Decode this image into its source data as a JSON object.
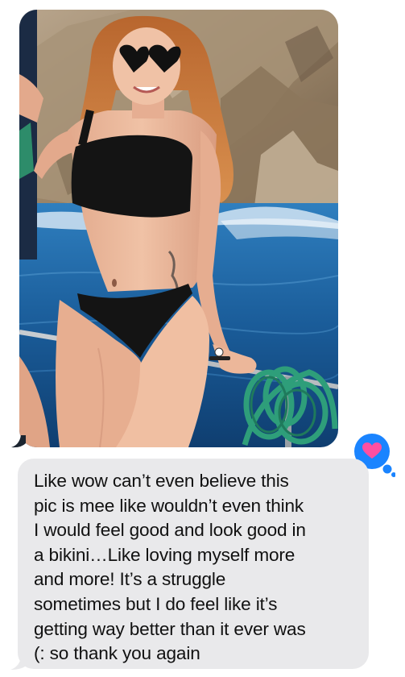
{
  "conversation": {
    "messages": [
      {
        "type": "photo",
        "sender": "incoming",
        "image_alt": "Photo of a woman in a black bikini and heart-shaped sunglasses sitting on the rail of a boat with blue sea and rocky cliffs behind her"
      },
      {
        "type": "text",
        "sender": "incoming",
        "text": "Like wow can’t even believe this\npic is mee like wouldn’t even think\nI would feel good and look good in\na bikini…Like loving myself more\nand more! It’s a struggle\nsometimes but I do feel like it’s\ngetting way better than it ever was\n(: so thank you again"
      }
    ],
    "reaction": {
      "icon": "heart-icon",
      "bubble_color": "#1a84ff",
      "heart_color": "#ff4fa1"
    },
    "colors": {
      "incoming_bubble": "#e9e9eb",
      "text": "#111111"
    }
  }
}
